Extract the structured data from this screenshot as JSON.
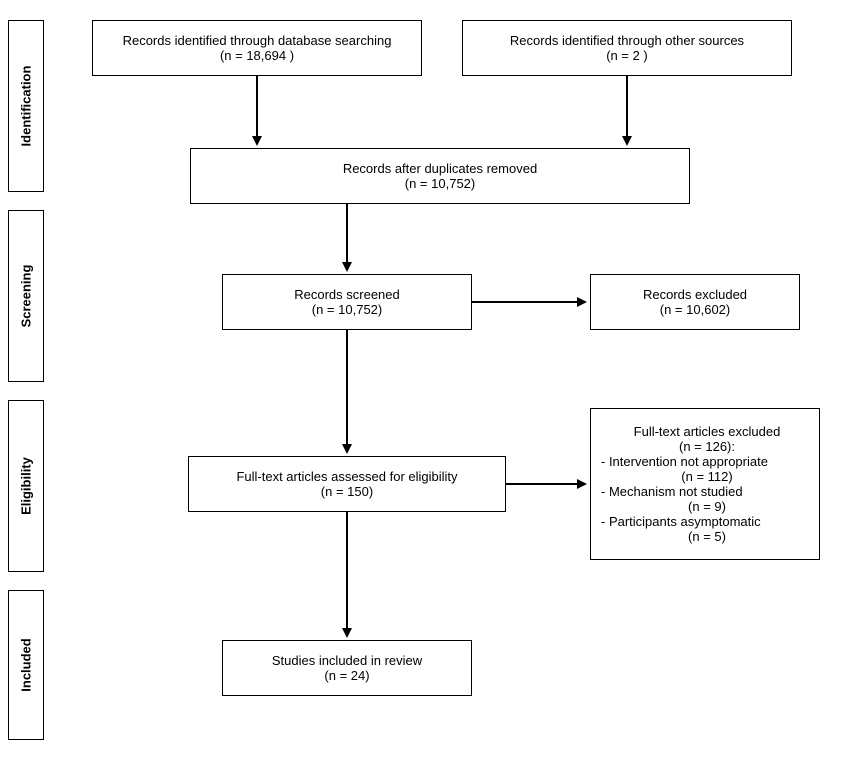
{
  "phases": {
    "identification": "Identification",
    "screening": "Screening",
    "eligibility": "Eligibility",
    "included": "Included"
  },
  "boxes": {
    "db_search": {
      "l1": "Records identified through database searching",
      "l2": "(n = 18,694 )"
    },
    "other_sources": {
      "l1": "Records identified through other sources",
      "l2": "(n = 2 )"
    },
    "after_dup": {
      "l1": "Records after duplicates removed",
      "l2": "(n = 10,752)"
    },
    "screened": {
      "l1": "Records screened",
      "l2": "(n = 10,752)"
    },
    "excluded1": {
      "l1": "Records excluded",
      "l2": "(n = 10,602)"
    },
    "fulltext": {
      "l1": "Full-text articles assessed for eligibility",
      "l2": "(n = 150)"
    },
    "excluded2": {
      "l1": "Full-text articles excluded",
      "l2": "(n = 126):",
      "l3": "- Intervention not appropriate",
      "l4": "(n = 112)",
      "l5": "- Mechanism not studied",
      "l6": "(n = 9)",
      "l7": "- Participants asymptomatic",
      "l8": "(n = 5)"
    },
    "included_final": {
      "l1": "Studies included in review",
      "l2": "(n = 24)"
    }
  },
  "chart_data": {
    "type": "diagram",
    "title": "PRISMA flow diagram",
    "records_identified_database": 18694,
    "records_identified_other": 2,
    "records_after_duplicates_removed": 10752,
    "records_screened": 10752,
    "records_excluded_screening": 10602,
    "fulltext_assessed": 150,
    "fulltext_excluded_total": 126,
    "fulltext_excluded_reasons": {
      "intervention_not_appropriate": 112,
      "mechanism_not_studied": 9,
      "participants_asymptomatic": 5
    },
    "studies_included": 24
  }
}
